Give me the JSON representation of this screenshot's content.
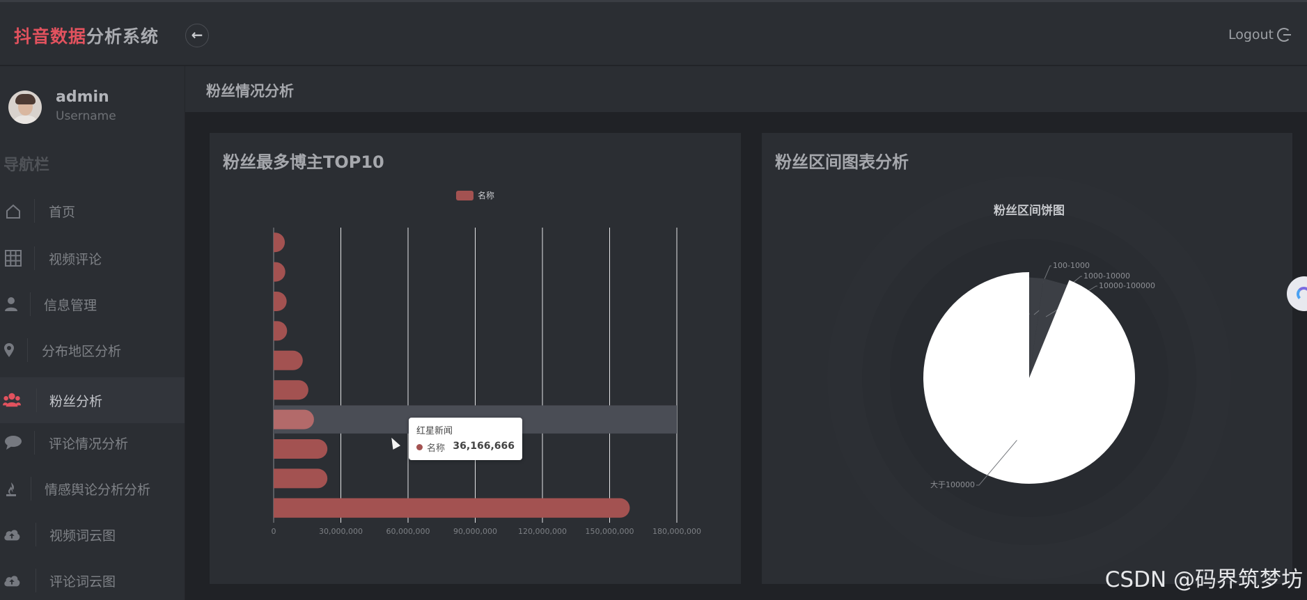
{
  "app": {
    "title_accent": "抖音数据",
    "title_rest": "分析系统",
    "logout_label": "Logout"
  },
  "user": {
    "name": "admin",
    "role": "Username"
  },
  "sidebar": {
    "title": "导航栏",
    "items": [
      {
        "label": "首页",
        "icon": "home-icon"
      },
      {
        "label": "视频评论",
        "icon": "grid-icon"
      },
      {
        "label": "信息管理",
        "icon": "user-icon"
      },
      {
        "label": "分布地区分析",
        "icon": "map-marker-icon"
      },
      {
        "label": "粉丝分析",
        "icon": "users-icon",
        "active": true
      },
      {
        "label": "评论情况分析",
        "icon": "comment-icon"
      },
      {
        "label": "情感舆论分析分析",
        "icon": "fire-extinguisher-icon"
      },
      {
        "label": "视频词云图",
        "icon": "cloud-upload-icon"
      },
      {
        "label": "评论词云图",
        "icon": "cloud-upload-icon"
      }
    ]
  },
  "page": {
    "title": "粉丝情况分析"
  },
  "panels": {
    "left_title": "粉丝最多博主TOP10",
    "right_title": "粉丝区间图表分析"
  },
  "tooltip": {
    "title": "红星新闻",
    "series": "名称",
    "value": "36,166,666"
  },
  "watermark": "CSDN @码界筑梦坊",
  "colors": {
    "accent": "#e2525e",
    "bar": "#a35251",
    "pie": "#ffffff"
  },
  "chart_data": [
    {
      "type": "bar",
      "orientation": "horizontal",
      "legend": [
        "名称"
      ],
      "series": [
        {
          "name": "名称",
          "values": [
            5000000,
            5200000,
            5800000,
            6000000,
            13000000,
            15500000,
            18000000,
            24000000,
            24000000,
            159000000
          ]
        }
      ],
      "categories": [
        "",
        "",
        "",
        "",
        "",
        "",
        "",
        "",
        "",
        ""
      ],
      "highlighted_index": 6,
      "xlim": [
        0,
        180000000
      ],
      "xticks": [
        "0",
        "30,000,000",
        "60,000,000",
        "90,000,000",
        "120,000,000",
        "150,000,000",
        "180,000,000"
      ],
      "grid": true
    },
    {
      "type": "pie",
      "title": "粉丝区间饼图",
      "slices": [
        {
          "label": "100-1000",
          "value": 1
        },
        {
          "label": "1000-10000",
          "value": 20
        },
        {
          "label": "10000-100000",
          "value": 35
        },
        {
          "label": "大于100000",
          "value": 850
        }
      ]
    }
  ]
}
